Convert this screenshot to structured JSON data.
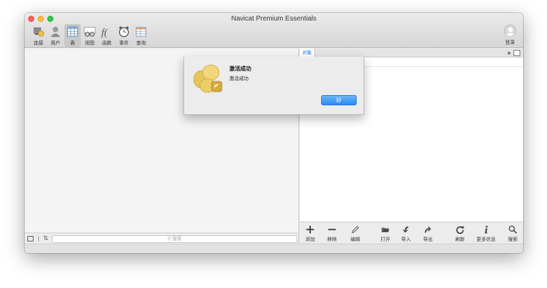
{
  "app": {
    "title": "Navicat Premium Essentials"
  },
  "toolbar": {
    "items": [
      {
        "label": "连接",
        "icon": "connection-icon"
      },
      {
        "label": "用户",
        "icon": "user-icon"
      },
      {
        "label": "表",
        "icon": "table-icon",
        "active": true
      },
      {
        "label": "视图",
        "icon": "view-icon"
      },
      {
        "label": "函数",
        "icon": "function-icon"
      },
      {
        "label": "事件",
        "icon": "event-clock-icon"
      },
      {
        "label": "查询",
        "icon": "query-icon"
      }
    ],
    "login_label": "登录"
  },
  "left_panel": {
    "search_placeholder": "搜索"
  },
  "right_panel": {
    "tab_label": "对象",
    "more_glyph": "»",
    "bottom_toolbar": [
      {
        "label": "添加",
        "icon": "plus-icon"
      },
      {
        "label": "移除",
        "icon": "minus-icon"
      },
      {
        "label": "编辑",
        "icon": "pencil-icon"
      },
      {
        "label": "打开",
        "icon": "folder-open-icon"
      },
      {
        "label": "导入",
        "icon": "import-arrow-icon"
      },
      {
        "label": "导出",
        "icon": "export-arrow-icon"
      },
      {
        "label": "刷新",
        "icon": "refresh-icon"
      },
      {
        "label": "更多信息",
        "icon": "info-icon"
      },
      {
        "label": "搜索",
        "icon": "search-icon"
      }
    ]
  },
  "dialog": {
    "title": "激活成功",
    "message": "激活成功",
    "ok_label": "好"
  },
  "colors": {
    "accent": "#2a8cf0",
    "tab_text": "#1a73d9",
    "close": "#fc605c",
    "minimize": "#fdbc40",
    "maximize": "#34c84a"
  }
}
